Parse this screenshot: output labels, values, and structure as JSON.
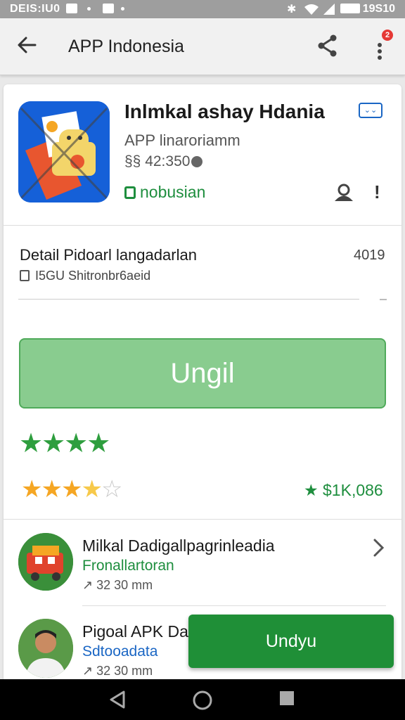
{
  "status_bar": {
    "left_text": "DEIS:IU0",
    "time": "19S10"
  },
  "app_bar": {
    "title": "APP Indonesia",
    "notification_count": "2"
  },
  "app": {
    "name": "Inlmkal ashay Hdania",
    "developer": "APP linaroriamm",
    "size": "§§ 42:350",
    "tag": "nobusian"
  },
  "detail": {
    "title": "Detail Pidoarl langadarlan",
    "number": "4019",
    "subtitle": "I5GU Shitronbr6aeid"
  },
  "main_button": {
    "label": "Ungil"
  },
  "rating": {
    "green_stars": 4,
    "gold_stars": 3.5,
    "gold_max": 5,
    "price": "$1K,086"
  },
  "list": [
    {
      "title": "Milkal Dadigallpagrinleadia",
      "subtitle": "Fronallartoran",
      "meta": "32 30 mm",
      "subtitle_color": "#1e8e3e"
    },
    {
      "title": "Pigoal APK Dad",
      "subtitle": "Sdtooadata",
      "meta": "32 30 mm",
      "subtitle_color": "#1a66c4"
    }
  ],
  "fab": {
    "label": "Undyu"
  },
  "colors": {
    "green": "#1e8e3e",
    "button_green": "#89cc8f",
    "blue": "#1a66c4",
    "star_gold": "#f5a623"
  }
}
